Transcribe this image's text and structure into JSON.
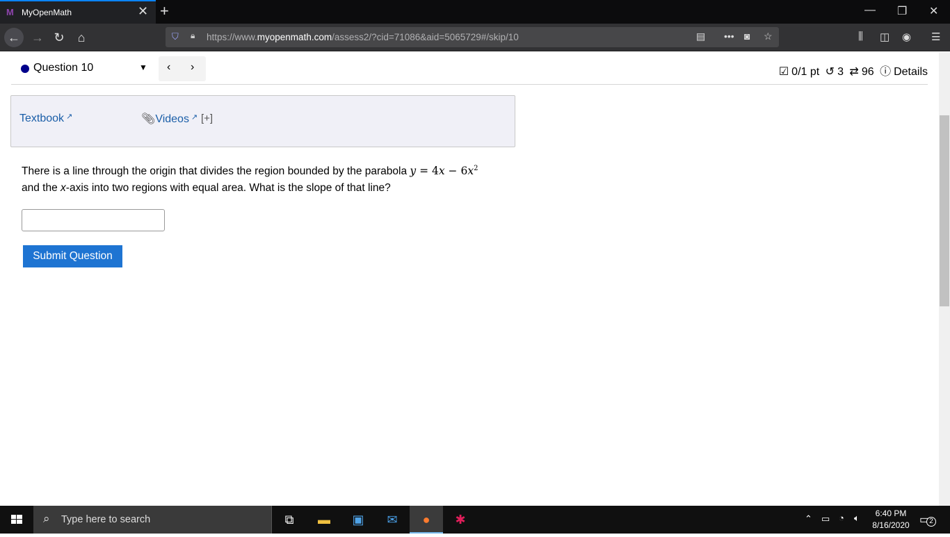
{
  "browser": {
    "tab_title": "MyOpenMath",
    "url_prefix": "https://www.",
    "url_domain": "myopenmath.com",
    "url_path": "/assess2/?cid=71086&aid=5065729#/skip/10"
  },
  "question_header": {
    "label": "Question 10",
    "points": "0/1 pt",
    "retries": "3",
    "attempts": "96",
    "details_label": "Details",
    "status_color": "#00008b"
  },
  "help": {
    "textbook_label": "Textbook",
    "videos_label": "Videos",
    "expand_label": "[+]"
  },
  "question": {
    "text_before": "There is a line through the origin that divides the region bounded by the parabola ",
    "math_y": "y",
    "math_eq": " = 4",
    "math_x1": "x",
    "math_minus": " − 6",
    "math_x2": "x",
    "math_exp": "2",
    "text_after_1": "and the ",
    "text_x_italic": "x",
    "text_after_2": "-axis into two regions with equal area. What is the slope of that line?"
  },
  "answer": {
    "value": "",
    "placeholder": ""
  },
  "submit_label": "Submit Question",
  "accent_color": "#1e74d2",
  "taskbar": {
    "search_placeholder": "Type here to search",
    "time": "6:40 PM",
    "date": "8/16/2020",
    "notification_count": "2"
  }
}
